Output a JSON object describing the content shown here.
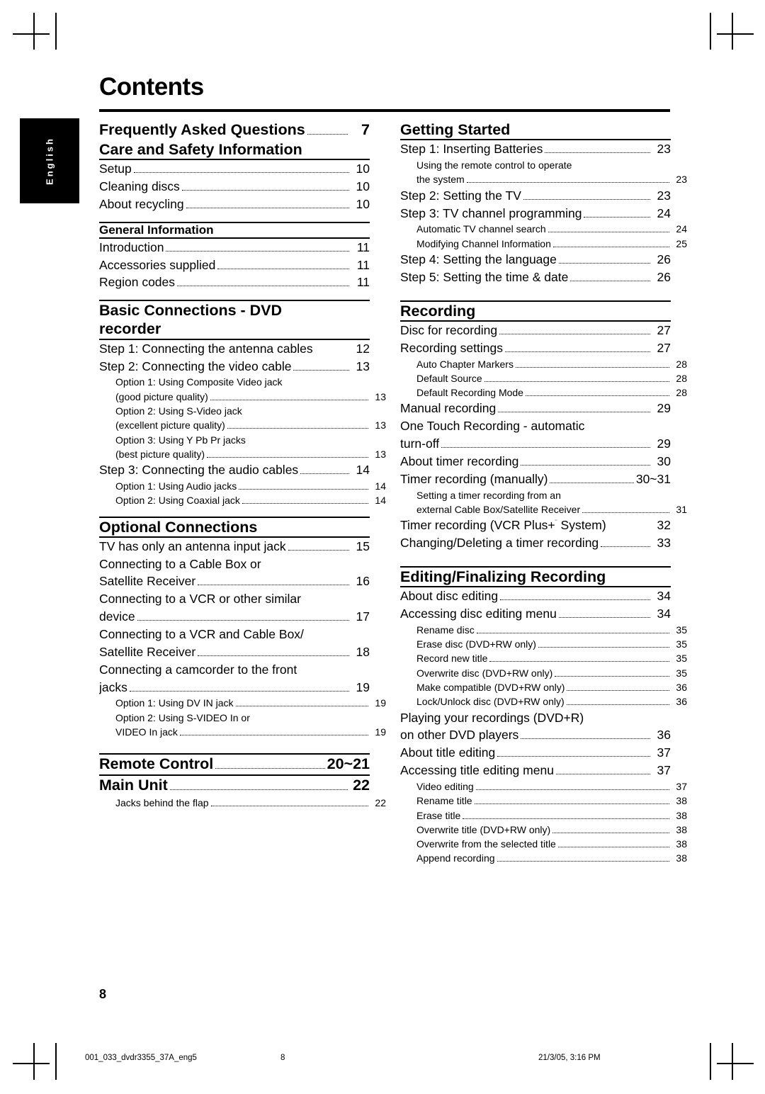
{
  "page": {
    "title": "Contents",
    "side_tab": "English",
    "folio": "8",
    "footer_left": "001_033_dvdr3355_37A_eng5",
    "footer_mid": "8",
    "footer_right": "21/3/05, 3:16 PM"
  },
  "left_column": [
    {
      "type": "big-entry",
      "text": "Frequently Asked Questions",
      "page": "7"
    },
    {
      "type": "h1",
      "text": "Care and Safety Information"
    },
    {
      "type": "rule"
    },
    {
      "type": "lvl1",
      "text": "Setup",
      "page": "10"
    },
    {
      "type": "lvl1",
      "text": "Cleaning discs",
      "page": "10"
    },
    {
      "type": "lvl1",
      "text": "About recycling",
      "page": "10"
    },
    {
      "type": "gap-m"
    },
    {
      "type": "rule"
    },
    {
      "type": "h2",
      "text": "General Information"
    },
    {
      "type": "rule"
    },
    {
      "type": "lvl1",
      "text": "Introduction",
      "page": "11"
    },
    {
      "type": "lvl1",
      "text": "Accessories supplied",
      "page": "11"
    },
    {
      "type": "lvl1",
      "text": "Region codes",
      "page": "11"
    },
    {
      "type": "gap-m"
    },
    {
      "type": "rule"
    },
    {
      "type": "h1",
      "text": "Basic Connections - DVD"
    },
    {
      "type": "h1",
      "text": "recorder"
    },
    {
      "type": "rule"
    },
    {
      "type": "lvl1",
      "text": "Step 1: Connecting the antenna cables",
      "page": "12",
      "noleader": true
    },
    {
      "type": "lvl1",
      "text": "Step 2: Connecting the video cable",
      "page": "13"
    },
    {
      "type": "lvl2",
      "text": "Option 1: Using Composite Video jack",
      "noleader": true
    },
    {
      "type": "lvl2",
      "text": "(good picture quality)",
      "page": "13"
    },
    {
      "type": "lvl2",
      "text": "Option 2: Using S-Video jack",
      "noleader": true
    },
    {
      "type": "lvl2",
      "text": "(excellent picture quality)",
      "page": "13"
    },
    {
      "type": "lvl2",
      "text": "Option 3: Using Y Pb Pr jacks",
      "noleader": true
    },
    {
      "type": "lvl2",
      "text": "(best picture quality)",
      "page": "13"
    },
    {
      "type": "lvl1",
      "text": "Step 3: Connecting the audio cables",
      "page": "14"
    },
    {
      "type": "lvl2",
      "text": "Option 1: Using Audio jacks",
      "page": "14"
    },
    {
      "type": "lvl2",
      "text": "Option 2: Using Coaxial jack",
      "page": "14"
    },
    {
      "type": "gap-m"
    },
    {
      "type": "rule"
    },
    {
      "type": "h1",
      "text": "Optional Connections"
    },
    {
      "type": "rule"
    },
    {
      "type": "lvl1",
      "text": "TV has only an antenna input jack",
      "page": "15"
    },
    {
      "type": "plain1",
      "text": "Connecting to a Cable Box or"
    },
    {
      "type": "lvl1",
      "text": "Satellite Receiver",
      "page": "16"
    },
    {
      "type": "plain1",
      "text": "Connecting to a VCR or other similar"
    },
    {
      "type": "lvl1",
      "text": "device",
      "page": "17"
    },
    {
      "type": "plain1",
      "text": "Connecting to a VCR and Cable Box/"
    },
    {
      "type": "lvl1",
      "text": "Satellite Receiver",
      "page": "18"
    },
    {
      "type": "plain1",
      "text": "Connecting a camcorder to the front"
    },
    {
      "type": "lvl1",
      "text": "jacks",
      "page": "19"
    },
    {
      "type": "lvl2",
      "text": "Option 1: Using DV IN jack",
      "page": "19"
    },
    {
      "type": "lvl2",
      "text": "Option 2: Using S-VIDEO In or"
    },
    {
      "type": "lvl2",
      "text": "VIDEO In jack",
      "page": "19"
    },
    {
      "type": "gap-l"
    },
    {
      "type": "rule"
    },
    {
      "type": "big-entry",
      "text": "Remote Control",
      "page": "20~21"
    },
    {
      "type": "rule"
    },
    {
      "type": "big-entry",
      "text": "Main Unit",
      "page": "22"
    },
    {
      "type": "lvl2",
      "text": "Jacks behind the flap",
      "page": "22"
    }
  ],
  "right_column": [
    {
      "type": "h1",
      "text": "Getting Started"
    },
    {
      "type": "rule"
    },
    {
      "type": "lvl1",
      "text": "Step 1: Inserting Batteries",
      "page": "23"
    },
    {
      "type": "lvl2",
      "text": "Using the remote control to operate"
    },
    {
      "type": "lvl2",
      "text": "the system",
      "page": "23"
    },
    {
      "type": "lvl1",
      "text": "Step 2: Setting the TV",
      "page": "23"
    },
    {
      "type": "lvl1",
      "text": "Step 3: TV channel programming",
      "page": "24"
    },
    {
      "type": "lvl2",
      "text": "Automatic TV channel search",
      "page": "24"
    },
    {
      "type": "lvl2",
      "text": "Modifying Channel Information",
      "page": "25"
    },
    {
      "type": "lvl1",
      "text": "Step 4: Setting the language",
      "page": "26"
    },
    {
      "type": "lvl1",
      "text": "Step 5: Setting the time & date",
      "page": "26"
    },
    {
      "type": "gap-l"
    },
    {
      "type": "rule"
    },
    {
      "type": "h1",
      "text": "Recording"
    },
    {
      "type": "rule"
    },
    {
      "type": "lvl1",
      "text": "Disc for recording",
      "page": "27"
    },
    {
      "type": "lvl1",
      "text": "Recording settings",
      "page": "27"
    },
    {
      "type": "lvl2",
      "text": "Auto Chapter Markers",
      "page": "28"
    },
    {
      "type": "lvl2",
      "text": "Default Source",
      "page": "28"
    },
    {
      "type": "lvl2",
      "text": "Default Recording Mode",
      "page": "28"
    },
    {
      "type": "lvl1",
      "text": "Manual recording",
      "page": "29"
    },
    {
      "type": "plain1",
      "text": "One Touch Recording - automatic"
    },
    {
      "type": "lvl1",
      "text": "turn-off",
      "page": "29"
    },
    {
      "type": "lvl1",
      "text": "About timer recording",
      "page": "30"
    },
    {
      "type": "lvl1",
      "text": "Timer recording (manually)",
      "page": "30~31"
    },
    {
      "type": "lvl2",
      "text": "Setting a timer recording from an"
    },
    {
      "type": "lvl2",
      "text": "external Cable Box/Satellite Receiver",
      "page": "31"
    },
    {
      "type": "lvl1-sup",
      "text": "Timer recording (VCR Plus+",
      "sup": "¨",
      "text2": " System)",
      "page": "32",
      "noleader": true
    },
    {
      "type": "lvl1",
      "text": "Changing/Deleting a timer recording",
      "page": "33"
    },
    {
      "type": "gap-l"
    },
    {
      "type": "rule"
    },
    {
      "type": "h1",
      "text": "Editing/Finalizing Recording"
    },
    {
      "type": "rule"
    },
    {
      "type": "lvl1",
      "text": "About disc editing",
      "page": "34"
    },
    {
      "type": "lvl1",
      "text": "Accessing disc editing menu",
      "page": "34"
    },
    {
      "type": "lvl2",
      "text": "Rename disc",
      "page": "35"
    },
    {
      "type": "lvl2",
      "text": "Erase disc (DVD+RW only)",
      "page": "35"
    },
    {
      "type": "lvl2",
      "text": "Record new title",
      "page": "35"
    },
    {
      "type": "lvl2",
      "text": "Overwrite disc (DVD+RW only)",
      "page": "35"
    },
    {
      "type": "lvl2",
      "text": "Make compatible (DVD+RW only)",
      "page": "36"
    },
    {
      "type": "lvl2",
      "text": "Lock/Unlock disc (DVD+RW only)",
      "page": "36"
    },
    {
      "type": "plain1",
      "text": "Playing your recordings (DVD+R)"
    },
    {
      "type": "lvl1",
      "text": "on other DVD players",
      "page": "36"
    },
    {
      "type": "lvl1",
      "text": "About title editing",
      "page": "37"
    },
    {
      "type": "lvl1",
      "text": "Accessing title editing menu",
      "page": "37"
    },
    {
      "type": "lvl2",
      "text": "Video editing",
      "page": "37"
    },
    {
      "type": "lvl2",
      "text": "Rename title",
      "page": "38"
    },
    {
      "type": "lvl2",
      "text": "Erase title",
      "page": "38"
    },
    {
      "type": "lvl2",
      "text": "Overwrite title (DVD+RW only)",
      "page": "38"
    },
    {
      "type": "lvl2",
      "text": "Overwrite from the selected title",
      "page": "38"
    },
    {
      "type": "lvl2",
      "text": "Append recording",
      "page": "38"
    }
  ]
}
